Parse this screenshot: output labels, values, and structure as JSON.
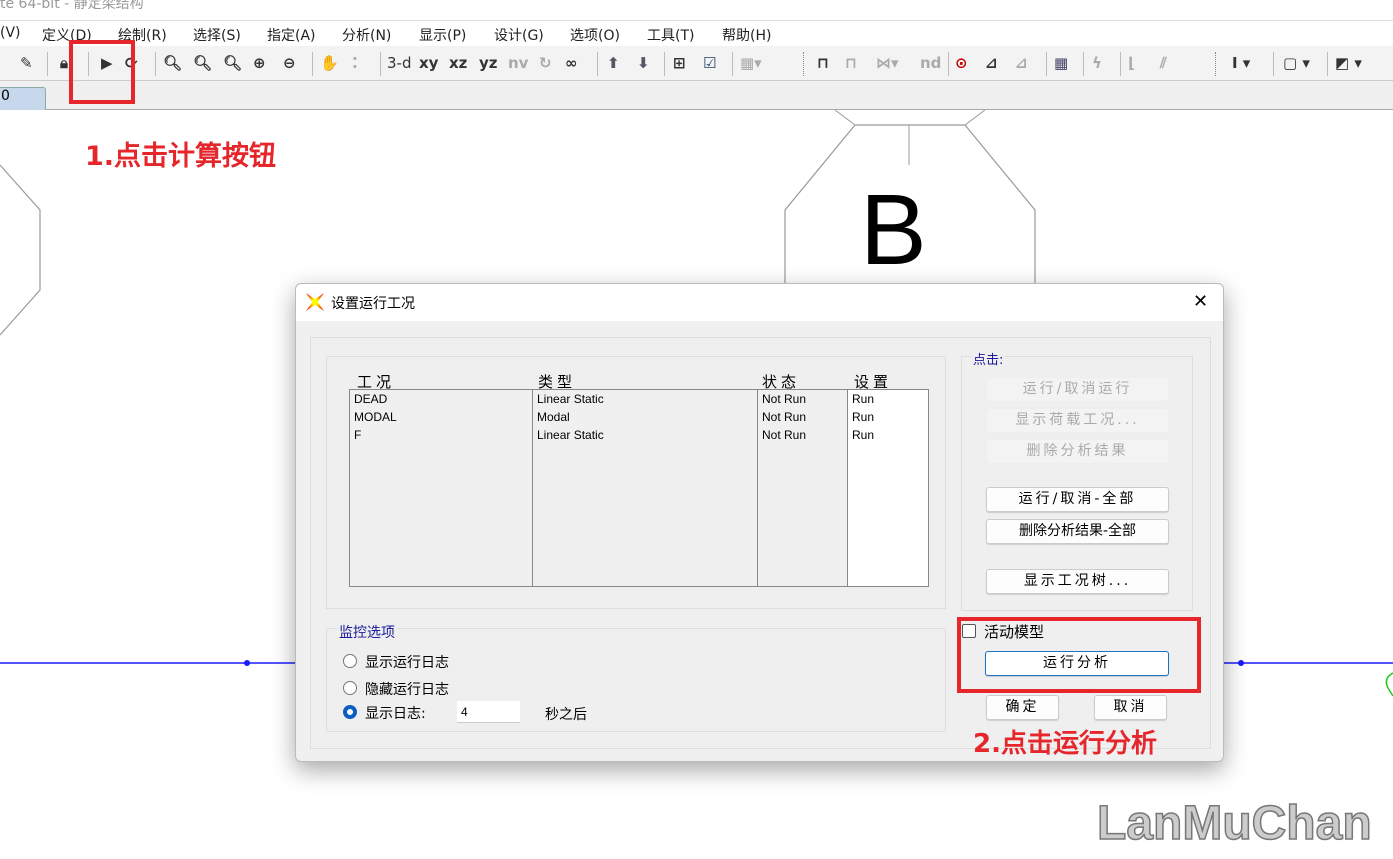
{
  "window": {
    "title": "te 64-bit - 静定梁结构"
  },
  "menu": [
    "(V)",
    "定义(D)",
    "绘制(R)",
    "选择(S)",
    "指定(A)",
    "分析(N)",
    "显示(P)",
    "设计(G)",
    "选项(O)",
    "工具(T)",
    "帮助(H)"
  ],
  "toolbar": {
    "view_3d": "3-d",
    "view_xy": "xy",
    "view_xz": "xz",
    "view_yz": "yz",
    "view_nv": "nv",
    "nd": "nd"
  },
  "tab": {
    "label": "0"
  },
  "canvas": {
    "axis_label": "B",
    "line_color": "#1a1aff"
  },
  "annotations": {
    "step1": "1.点击计算按钮",
    "step2": "2.点击运行分析",
    "color": "#e5262b"
  },
  "watermark": "LanMuChan",
  "dialog": {
    "title": "设置运行工况",
    "close": "✕",
    "table": {
      "headers": [
        "工况",
        "类型",
        "状态",
        "设置"
      ],
      "rows": [
        [
          "DEAD",
          "Linear Static",
          "Not Run",
          "Run"
        ],
        [
          "MODAL",
          "Modal",
          "Not Run",
          "Run"
        ],
        [
          "F",
          "Linear Static",
          "Not Run",
          "Run"
        ]
      ]
    },
    "click_group": {
      "label": "点击:",
      "buttons": [
        {
          "label": "运行/取消运行",
          "enabled": false
        },
        {
          "label": "显示荷载工况...",
          "enabled": false
        },
        {
          "label": "删除分析结果",
          "enabled": false
        },
        {
          "label": "运行/取消-全部",
          "enabled": true
        },
        {
          "label": "删除分析结果-全部",
          "enabled": true
        },
        {
          "label": "显示工况树...",
          "enabled": true
        }
      ]
    },
    "monitor": {
      "label": "监控选项",
      "options": [
        "显示运行日志",
        "隐藏运行日志",
        "显示日志:"
      ],
      "selected": 2,
      "seconds": "4",
      "seconds_suffix": "秒之后"
    },
    "active_model": {
      "label": "活动模型",
      "checked": false
    },
    "run_button": "运行分析",
    "ok": "确定",
    "cancel": "取消"
  }
}
